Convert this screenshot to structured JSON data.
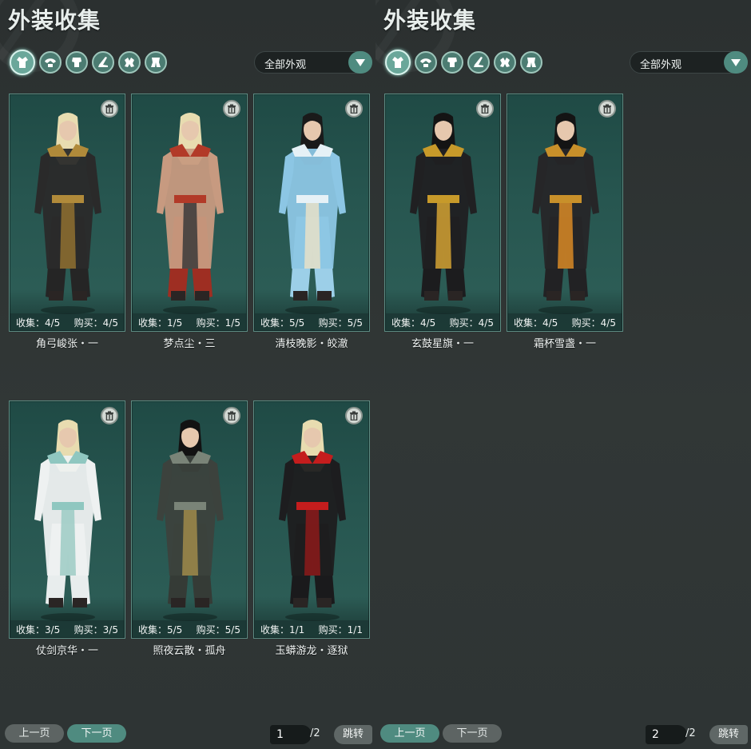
{
  "panels": [
    {
      "title": "外装收集",
      "category_icons": [
        {
          "name": "robe-icon",
          "active": true
        },
        {
          "name": "shoulder-icon",
          "active": false
        },
        {
          "name": "torso-icon",
          "active": false
        },
        {
          "name": "boot-icon",
          "active": false
        },
        {
          "name": "gloves-icon",
          "active": false
        },
        {
          "name": "legs-icon",
          "active": false
        }
      ],
      "filter_label": "全部外观",
      "cards": [
        {
          "collect": "收集：4/5",
          "buy": "购买：4/5",
          "name": "角弓峻张・一",
          "colors": {
            "hair": "#e8dcb0",
            "body": "#2a2a2a",
            "trim": "#b08a3a",
            "lower": "#252525",
            "accent": "#8f7030"
          }
        },
        {
          "collect": "收集：1/5",
          "buy": "购买：1/5",
          "name": "梦点尘・三",
          "colors": {
            "hair": "#e8dcb0",
            "body": "#c79a80",
            "trim": "#b23a28",
            "lower": "#9e2e22",
            "accent": "#3a3a3a"
          }
        },
        {
          "collect": "收集：5/5",
          "buy": "购买：5/5",
          "name": "清枝晚影・皎澈",
          "colors": {
            "hair": "#1a1a1a",
            "body": "#8cc6e4",
            "trim": "#e6f1f6",
            "lower": "#9ccfe8",
            "accent": "#e8e0c8"
          }
        },
        {
          "collect": "收集：3/5",
          "buy": "购买：3/5",
          "name": "仗剑京华・一",
          "colors": {
            "hair": "#e8dcb0",
            "body": "#eef1f1",
            "trim": "#8fc7c0",
            "lower": "#e8eded",
            "accent": "#9ccbc4"
          }
        },
        {
          "collect": "收集：5/5",
          "buy": "购买：5/5",
          "name": "照夜云散・孤舟",
          "colors": {
            "hair": "#121212",
            "body": "#3c423d",
            "trim": "#7a8478",
            "lower": "#353b36",
            "accent": "#a08a4a"
          }
        },
        {
          "collect": "收集：1/1",
          "buy": "购买：1/1",
          "name": "玉蟒游龙・逐狱",
          "colors": {
            "hair": "#e8dcb0",
            "body": "#1d1d1f",
            "trim": "#c41d1d",
            "lower": "#1a1a1c",
            "accent": "#8c1a1a"
          }
        }
      ],
      "pager": {
        "prev": "上一页",
        "next": "下一页",
        "page": "1",
        "total": "/2",
        "jump": "跳转"
      }
    },
    {
      "title": "外装收集",
      "category_icons": [
        {
          "name": "robe-icon",
          "active": true
        },
        {
          "name": "shoulder-icon",
          "active": false
        },
        {
          "name": "torso-icon",
          "active": false
        },
        {
          "name": "boot-icon",
          "active": false
        },
        {
          "name": "gloves-icon",
          "active": false
        },
        {
          "name": "legs-icon",
          "active": false
        }
      ],
      "filter_label": "全部外观",
      "cards": [
        {
          "collect": "收集：4/5",
          "buy": "购买：4/5",
          "name": "玄鼓星旗・一",
          "colors": {
            "hair": "#141414",
            "body": "#202022",
            "trim": "#c79a2a",
            "lower": "#1c1c1e",
            "accent": "#d4a232"
          }
        },
        {
          "collect": "收集：4/5",
          "buy": "购买：4/5",
          "name": "霜杯雪盏・一",
          "colors": {
            "hair": "#141414",
            "body": "#262628",
            "trim": "#c8902a",
            "lower": "#222224",
            "accent": "#d98a26"
          }
        }
      ],
      "pager": {
        "prev": "上一页",
        "next": "下一页",
        "page": "2",
        "total": "/2",
        "jump": "跳转"
      }
    }
  ]
}
